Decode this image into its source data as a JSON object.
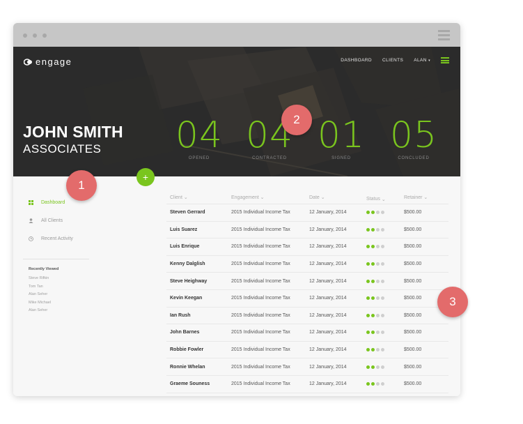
{
  "colors": {
    "accent": "#7ac51e",
    "badge": "#e36b6b",
    "dot_filled": "#7ac51e",
    "dot_empty": "#cfcfcf"
  },
  "app": {
    "logo": "engage"
  },
  "nav": {
    "dashboard": "DASHBOARD",
    "clients": "CLIENTS",
    "user": "ALAN",
    "caret": "▾"
  },
  "client": {
    "name": "JOHN SMITH",
    "subtitle": "ASSOCIATES"
  },
  "stats": [
    {
      "value": "04",
      "label": "OPENED"
    },
    {
      "value": "04",
      "label": "CONTRACTED"
    },
    {
      "value": "01",
      "label": "SIGNED"
    },
    {
      "value": "05",
      "label": "CONCLUDED"
    }
  ],
  "add_button": {
    "label": "+"
  },
  "sidebar": {
    "items": [
      {
        "label": "Dashboard",
        "icon": "grid-icon"
      },
      {
        "label": "All Clients",
        "icon": "user-icon"
      },
      {
        "label": "Recent Activity",
        "icon": "clock-icon"
      }
    ],
    "recent_title": "Recently Viewed",
    "recent": [
      "Steve Rifkin",
      "Tom Tan",
      "Alan Seher",
      "Mike Michael",
      "Alan Seher"
    ]
  },
  "table": {
    "headers": [
      "Client",
      "Engagement",
      "Date",
      "Status",
      "Retainer"
    ],
    "sort_marker": "⌄",
    "rows": [
      {
        "client": "Steven Gerrard",
        "engagement": "2015 Individual Income Tax",
        "date": "12 January, 2014",
        "status": 2,
        "retainer": "$500.00"
      },
      {
        "client": "Luis Suarez",
        "engagement": "2015 Individual Income Tax",
        "date": "12 January, 2014",
        "status": 2,
        "retainer": "$500.00"
      },
      {
        "client": "Luis Enrique",
        "engagement": "2015 Individual Income Tax",
        "date": "12 January, 2014",
        "status": 2,
        "retainer": "$500.00"
      },
      {
        "client": "Kenny Dalglish",
        "engagement": "2015 Individual Income Tax",
        "date": "12 January, 2014",
        "status": 2,
        "retainer": "$500.00"
      },
      {
        "client": "Steve Heighway",
        "engagement": "2015 Individual Income Tax",
        "date": "12 January, 2014",
        "status": 2,
        "retainer": "$500.00"
      },
      {
        "client": "Kevin Keegan",
        "engagement": "2015 Individual Income Tax",
        "date": "12 January, 2014",
        "status": 2,
        "retainer": "$500.00"
      },
      {
        "client": "Ian Rush",
        "engagement": "2015 Individual Income Tax",
        "date": "12 January, 2014",
        "status": 2,
        "retainer": "$500.00"
      },
      {
        "client": "John Barnes",
        "engagement": "2015 Individual Income Tax",
        "date": "12 January, 2014",
        "status": 2,
        "retainer": "$500.00"
      },
      {
        "client": "Robbie Fowler",
        "engagement": "2015 Individual Income Tax",
        "date": "12 January, 2014",
        "status": 2,
        "retainer": "$500.00"
      },
      {
        "client": "Ronnie Whelan",
        "engagement": "2015 Individual Income Tax",
        "date": "12 January, 2014",
        "status": 2,
        "retainer": "$500.00"
      },
      {
        "client": "Graeme Souness",
        "engagement": "2015 Individual Income Tax",
        "date": "12 January, 2014",
        "status": 2,
        "retainer": "$500.00"
      }
    ]
  },
  "badges": [
    "1",
    "2",
    "3"
  ]
}
